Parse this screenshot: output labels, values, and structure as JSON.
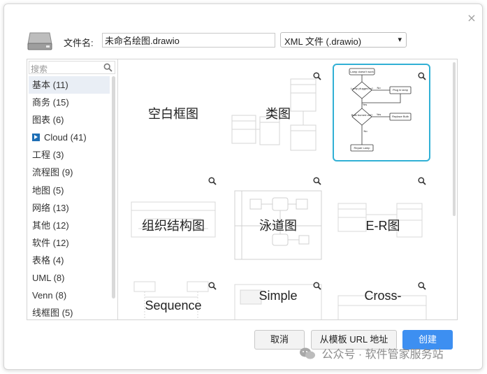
{
  "dialog": {
    "close_symbol": "×",
    "file_label": "文件名:",
    "file_name_value": "未命名绘图.drawio",
    "file_type_value": "XML 文件 (.drawio)",
    "icons": {
      "header": "disk-drive-icon",
      "close": "close-icon",
      "search": "search-icon",
      "zoom": "zoom-icon"
    }
  },
  "search": {
    "placeholder": "搜索"
  },
  "categories": [
    {
      "label": "基本 (11)",
      "active": true
    },
    {
      "label": "商务 (15)"
    },
    {
      "label": "图表 (6)"
    },
    {
      "label": "Cloud (41)",
      "icon": "cloud-category-icon"
    },
    {
      "label": "工程 (3)"
    },
    {
      "label": "流程图 (9)"
    },
    {
      "label": "地图 (5)"
    },
    {
      "label": "网络 (13)"
    },
    {
      "label": "其他 (12)"
    },
    {
      "label": "软件 (12)"
    },
    {
      "label": "表格 (4)"
    },
    {
      "label": "UML (8)"
    },
    {
      "label": "Venn (8)"
    },
    {
      "label": "线框图 (5)"
    }
  ],
  "templates": [
    {
      "label": "空白框图"
    },
    {
      "label": "类图"
    },
    {
      "label": "",
      "selected": true,
      "flow_texts": [
        "Lamp doesn't work",
        "Lamp plugged in?",
        "No",
        "Plug in lamp",
        "Yes",
        "Bulb burned out?",
        "Yes",
        "Replace Bulb",
        "No",
        "Repair Lamp"
      ]
    },
    {
      "label": "组织结构图"
    },
    {
      "label": "泳道图"
    },
    {
      "label": "E-R图"
    },
    {
      "label": "Sequence"
    },
    {
      "label": "Simple"
    },
    {
      "label": "Cross-"
    }
  ],
  "buttons": {
    "cancel": "取消",
    "from_url": "从模板 URL 地址",
    "create": "创建"
  },
  "colors": {
    "accent": "#3d8ff1",
    "selected_border": "#31b0d5",
    "active_category": "#e9eef5"
  },
  "watermark": {
    "text": "公众号 · 软件管家服务站"
  }
}
